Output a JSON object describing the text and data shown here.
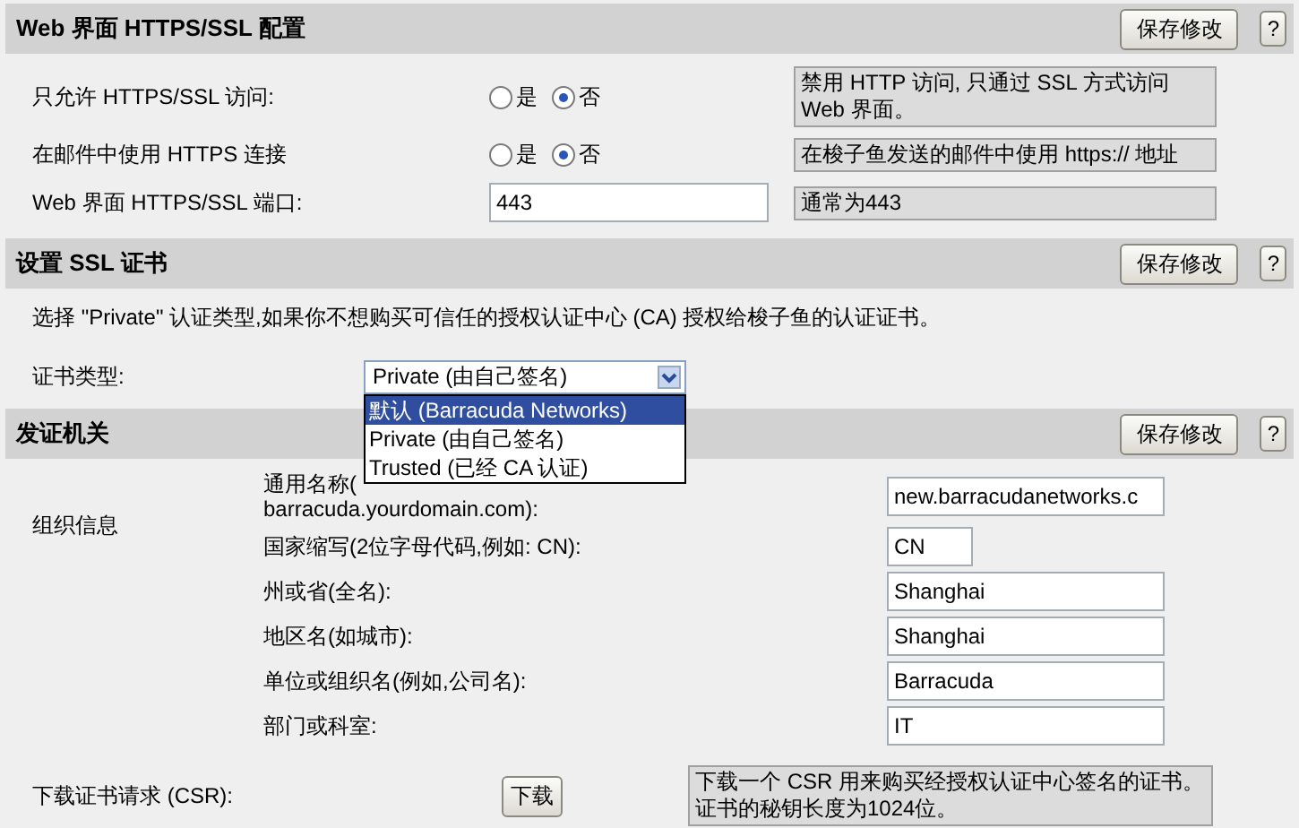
{
  "sections": [
    {
      "title": "Web 界面 HTTPS/SSL 配置",
      "save_button": "保存修改",
      "help_button": "?",
      "rows": [
        {
          "kind": "radio",
          "label": "只允许 HTTPS/SSL 访问:",
          "options": [
            {
              "label": "是",
              "selected": false
            },
            {
              "label": "否",
              "selected": true
            }
          ],
          "note": "禁用 HTTP 访问, 只通过 SSL 方式访问 Web 界面。"
        },
        {
          "kind": "radio",
          "label": "在邮件中使用 HTTPS 连接",
          "options": [
            {
              "label": "是",
              "selected": false
            },
            {
              "label": "否",
              "selected": true
            }
          ],
          "note": "在梭子鱼发送的邮件中使用 https:// 地址"
        },
        {
          "kind": "input",
          "label": "Web 界面 HTTPS/SSL 端口:",
          "value": "443",
          "note": "通常为443"
        }
      ]
    },
    {
      "title": "设置 SSL 证书",
      "save_button": "保存修改",
      "help_button": "?",
      "rows": [
        {
          "kind": "text",
          "text": "选择 \"Private\" 认证类型,如果你不想购买可信任的授权认证中心 (CA) 授权给梭子鱼的认证证书。"
        },
        {
          "kind": "select",
          "label": "证书类型:",
          "value": "Private (由自己签名)",
          "expanded": true,
          "options": [
            {
              "label": "默认 (Barracuda Networks)",
              "highlighted": true
            },
            {
              "label": "Private (由自己签名)",
              "highlighted": false
            },
            {
              "label": "Trusted (已经 CA 认证)",
              "highlighted": false
            }
          ]
        }
      ]
    },
    {
      "title": "发证机关",
      "save_button": "保存修改",
      "help_button": "?",
      "rows": [
        {
          "kind": "fields",
          "label": "组织信息",
          "fields": [
            {
              "kind": "long",
              "label_lines": [
                "通用名称(",
                "barracuda.yourdomain.com):"
              ],
              "value": "new.barracudanetworks.c"
            },
            {
              "kind": "short",
              "label_lines": [
                "国家缩写(2位字母代码,例如: CN):"
              ],
              "value": "CN"
            },
            {
              "kind": "long",
              "label_lines": [
                "州或省(全名):"
              ],
              "value": "Shanghai"
            },
            {
              "kind": "long",
              "label_lines": [
                "地区名(如城市):"
              ],
              "value": "Shanghai"
            },
            {
              "kind": "long",
              "label_lines": [
                "单位或组织名(例如,公司名):"
              ],
              "value": "Barracuda"
            },
            {
              "kind": "long",
              "label_lines": [
                "部门或科室:"
              ],
              "value": "IT"
            }
          ]
        },
        {
          "kind": "download",
          "label": "下载证书请求 (CSR):",
          "button": "下载",
          "note": "下载一个 CSR 用来购买经授权认证中心签名的证书。证书的秘钥长度为1024位。"
        }
      ]
    }
  ]
}
